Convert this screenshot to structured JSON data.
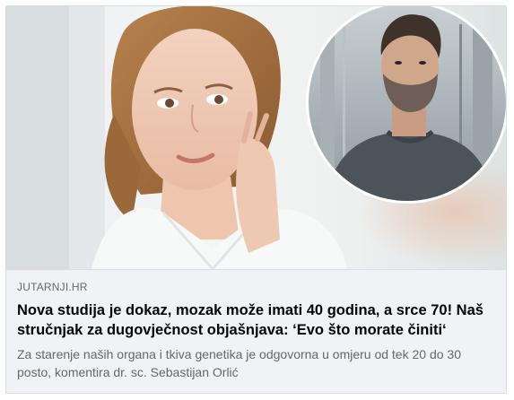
{
  "link_preview": {
    "image_description_alt": "",
    "source": "JUTARNJI.HR",
    "headline": "Nova studija je dokaz, mozak može imati 40 godina, a srce 70! Naš stručnjak za dugovječnost objašnjava: ‘Evo što morate činiti‘",
    "description": "Za starenje naših organa i tkiva genetika je odgovorna u omjeru od tek 20 do 30 posto, komentira dr. sc. Sebastijan Orlić"
  },
  "colors": {
    "background": "#f0f2f5",
    "source_text": "#65676b",
    "headline_text": "#050505",
    "border": "#dadde1"
  }
}
